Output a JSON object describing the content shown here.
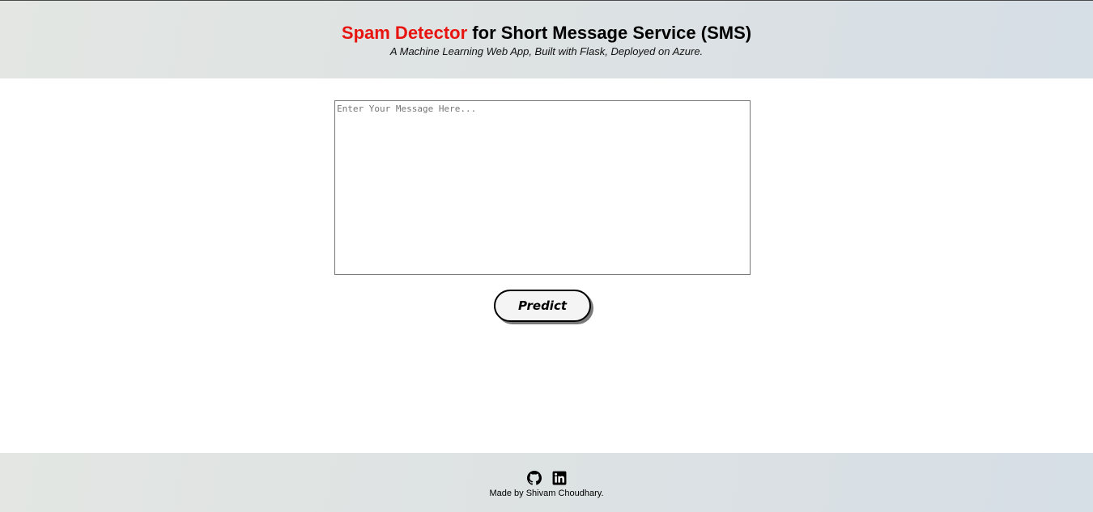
{
  "header": {
    "title_accent": "Spam Detector",
    "title_rest": " for Short Message Service (SMS)",
    "subtitle": "A Machine Learning Web App, Built with Flask, Deployed on Azure."
  },
  "form": {
    "message_value": "",
    "message_placeholder": "Enter Your Message Here...",
    "predict_label": "Predict"
  },
  "footer": {
    "icons": [
      "github-icon",
      "linkedin-icon"
    ],
    "credit": "Made by Shivam Choudhary."
  },
  "colors": {
    "accent": "#e8140f",
    "text": "#000000"
  }
}
